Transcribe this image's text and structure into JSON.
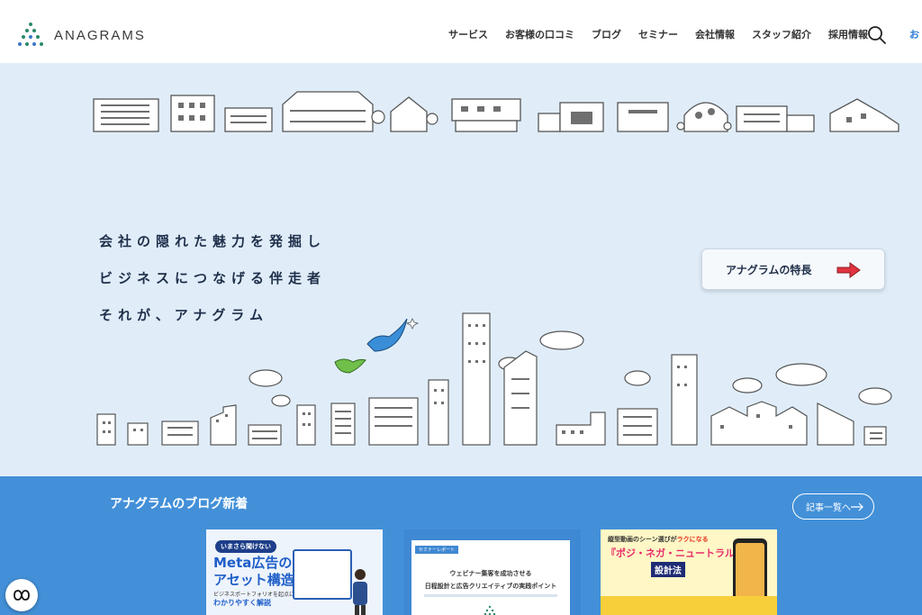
{
  "brand": {
    "name": "ANAGRAMS"
  },
  "nav": {
    "items": [
      "サービス",
      "お客様の口コミ",
      "ブログ",
      "セミナー",
      "会社情報",
      "スタッフ紹介",
      "採用情報"
    ],
    "cut_item": "お"
  },
  "hero": {
    "tagline": [
      "会社の隠れた魅力を発掘し",
      "ビジネスにつなげる伴走者",
      "それが、アナグラム"
    ],
    "feature_button": "アナグラムの特長"
  },
  "blog": {
    "title": "アナグラムのブログ新着",
    "all_button": "記事一覧へ",
    "cards": [
      {
        "pill": "いまさら聞けない",
        "headline_1": "Meta広告の",
        "headline_2": "アセット構造",
        "sub_1": "ビジネスポートフォリオを起点に",
        "sub_2": "わかりやすく解説"
      },
      {
        "tag": "セミナーレポート",
        "line_1": "ウェビナー集客を成功させる",
        "line_2": "日程設計と広告クリエイティブの実践ポイント"
      },
      {
        "top_1": "縦型動画のシーン選びが",
        "top_2": "ラクになる",
        "headline": "『ポジ・ネガ・ニュートラル』",
        "sub": "設計法"
      }
    ]
  },
  "colors": {
    "hero_bg": "#e0edf9",
    "blog_bg": "#4390d8",
    "accent": "#2a7bd4",
    "arrow": "#e0333f",
    "bird_blue": "#3a8ed8",
    "bird_green": "#6fbf4a"
  },
  "icons": [
    "search-icon",
    "arrow-right-icon",
    "chat-icon"
  ]
}
